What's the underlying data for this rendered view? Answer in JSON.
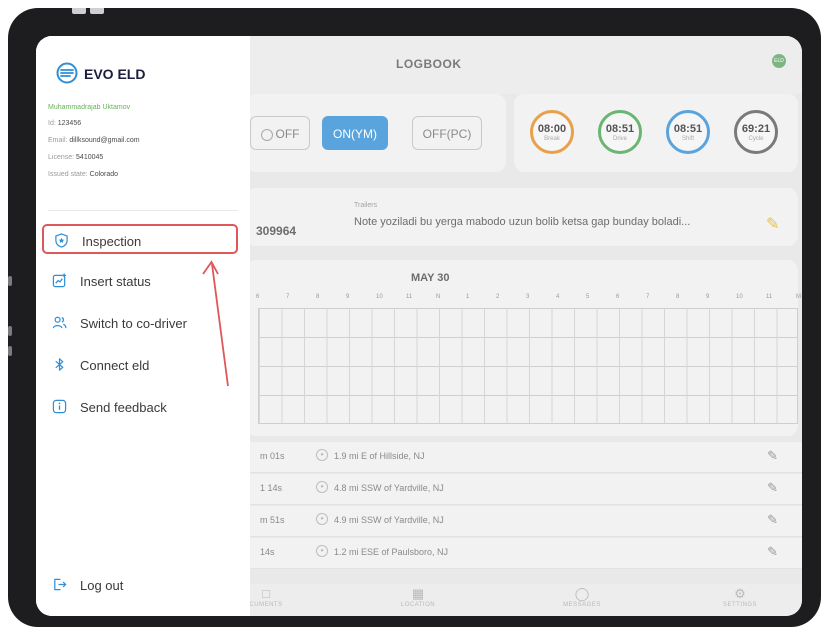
{
  "app": {
    "title": "LOGBOOK",
    "eld_badge": "ELD"
  },
  "status": {
    "off_label": "OFF",
    "on_label": "ON(YM)",
    "offpc_label": "OFF(PC)",
    "active": "ON(YM)",
    "active_color": "#5aa4de"
  },
  "timers": [
    {
      "value": "08:00",
      "label": "Break",
      "color": "#e8a04a"
    },
    {
      "value": "08:51",
      "label": "Drive",
      "color": "#6bb573"
    },
    {
      "value": "08:51",
      "label": "Shift",
      "color": "#5aa4de"
    },
    {
      "value": "69:21",
      "label": "Cycle",
      "color": "#7a7a7a"
    }
  ],
  "vehicle": {
    "number_partial": "309964",
    "trailers_label": "Trailers",
    "trailers_value": "Note yoziladi bu yerga mabodo uzun bolib ketsa gap bunday boladi..."
  },
  "log": {
    "date": "MAY 30",
    "hours": [
      "6",
      "7",
      "8",
      "9",
      "10",
      "11",
      "N",
      "1",
      "2",
      "3",
      "4",
      "5",
      "6",
      "7",
      "8",
      "9",
      "10",
      "11",
      "M"
    ],
    "rows": [
      {
        "duration": "m 01s",
        "location": "1.9 mi E of Hillside, NJ"
      },
      {
        "duration": "1 14s",
        "location": "4.8 mi SSW of Yardville, NJ"
      },
      {
        "duration": "m 51s",
        "location": "4.9 mi SSW of Yardville, NJ"
      },
      {
        "duration": "14s",
        "location": "1.2 mi ESE of Paulsboro, NJ"
      }
    ]
  },
  "tabbar": {
    "documents": "CUMENTS",
    "location": "LOCATION",
    "messages": "MESSAGES",
    "settings": "SETTINGS"
  },
  "drawer": {
    "brand": "EVO ELD",
    "user_name": "Muhammadrajab Uktamov",
    "id_label": "Id:",
    "id_value": "123456",
    "email_label": "Email:",
    "email_value": "dillksound@gmail.com",
    "license_label": "License:",
    "license_value": "5410045",
    "state_label": "Issued state:",
    "state_value": "Colorado",
    "menu": [
      {
        "label": "Inspection",
        "icon": "shield-star-icon"
      },
      {
        "label": "Insert status",
        "icon": "chart-plus-icon"
      },
      {
        "label": "Switch to co-driver",
        "icon": "users-icon"
      },
      {
        "label": "Connect eld",
        "icon": "bluetooth-icon"
      },
      {
        "label": "Send feedback",
        "icon": "info-icon"
      }
    ],
    "selected": "Inspection",
    "logout": "Log out",
    "accent": "#5aa4de",
    "highlight_color": "#e0575a"
  }
}
